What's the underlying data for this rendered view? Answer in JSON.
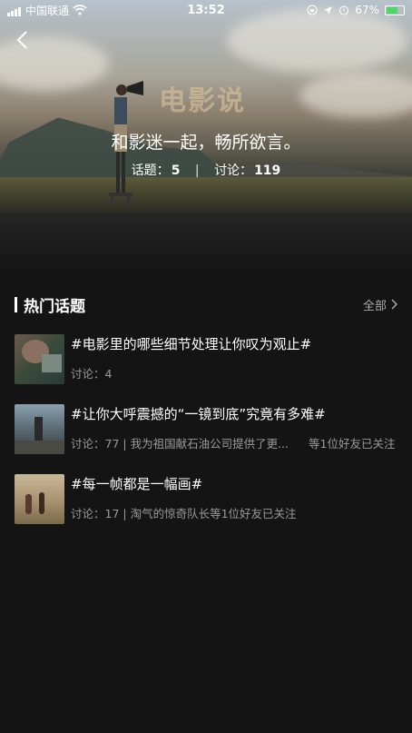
{
  "status_bar": {
    "carrier": "中国联通",
    "time": "13:52",
    "battery": "67%"
  },
  "header": {
    "title": "电影说",
    "subtitle": "和影迷一起，畅所欲言。",
    "topics_label": "话题：",
    "topics_count": "5",
    "discussions_label": "讨论：",
    "discussions_count": "119"
  },
  "section": {
    "title": "热门话题",
    "more_label": "全部"
  },
  "topics": [
    {
      "title": "#电影里的哪些细节处理让你叹为观止#",
      "meta": "讨论：4",
      "friends": ""
    },
    {
      "title": "#让你大呼震撼的“一镜到底”究竟有多难#",
      "meta": "讨论：77 | 我为祖国献石油公司提供了更...",
      "friends": "等1位好友已关注"
    },
    {
      "title": "#每一帧都是一幅画#",
      "meta": "讨论：17 | 淘气的惊奇队长等1位好友已关注",
      "friends": ""
    }
  ],
  "colors": {
    "background": "#141414",
    "accent_title": "#e6c8a0",
    "muted_text": "#9a9a9a"
  }
}
